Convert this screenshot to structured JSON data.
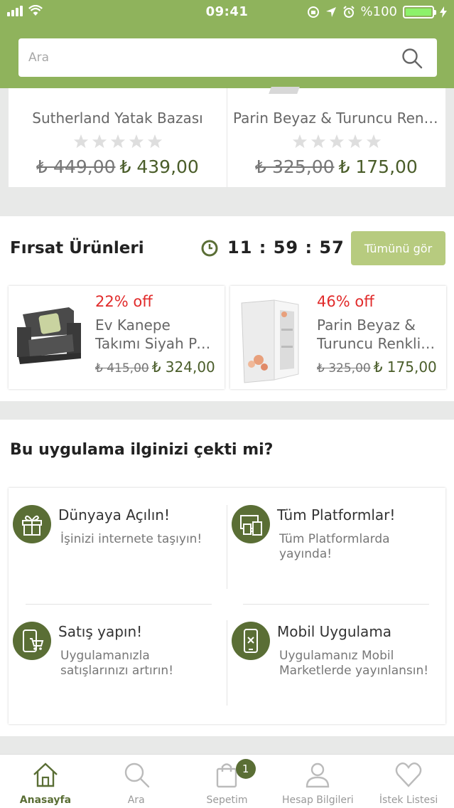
{
  "status_bar": {
    "time": "09:41",
    "battery_percent": "%100",
    "battery_level": 1.0
  },
  "search": {
    "placeholder": "Ara"
  },
  "products": [
    {
      "name": "Sutherland Yatak Bazası",
      "old_price": "₺ 449,00",
      "new_price": "₺ 439,00",
      "rating": 0,
      "max_rating": 5
    },
    {
      "name": "Parin Beyaz & Turuncu Renkli Çocuk Odası",
      "old_price": "₺ 325,00",
      "new_price": "₺ 175,00",
      "rating": 0,
      "max_rating": 5
    }
  ],
  "deals": {
    "title": "Fırsat Ürünleri",
    "countdown": "11 : 59 : 57",
    "see_all_label": "Tümünü gör",
    "items": [
      {
        "discount": "22% off",
        "name_line1": "Ev Kanepe",
        "name_line2": "Takımı Siyah Panama",
        "old_price": "₺ 415,00",
        "new_price": "₺ 324,00"
      },
      {
        "discount": "46% off",
        "name_line1": "Parin Beyaz &",
        "name_line2": "Turuncu Renkli Dolap",
        "old_price": "₺ 325,00",
        "new_price": "₺ 175,00"
      }
    ]
  },
  "promo": {
    "title": "Bu uygulama ilginizi çekti mi?",
    "features": [
      {
        "icon": "gift-icon",
        "title": "Dünyaya Açılın!",
        "desc": "İşinizi internete taşıyın!"
      },
      {
        "icon": "devices-icon",
        "title": "Tüm Platformlar!",
        "desc": "Tüm Platformlarda yayında!"
      },
      {
        "icon": "mobile-cart-icon",
        "title": "Satış yapın!",
        "desc": "Uygulamanızla satışlarınızı artırın!"
      },
      {
        "icon": "mobile-app-icon",
        "title": "Mobil Uygulama",
        "desc": "Uygulamanız Mobil Marketlerde yayınlansın!"
      }
    ]
  },
  "tabbar": {
    "tabs": [
      {
        "label": "Anasayfa",
        "icon": "home-icon",
        "active": true
      },
      {
        "label": "Ara",
        "icon": "search-icon",
        "active": false
      },
      {
        "label": "Sepetim",
        "icon": "bag-icon",
        "active": false,
        "badge": "1"
      },
      {
        "label": "Hesap Bilgileri",
        "icon": "user-icon",
        "active": false
      },
      {
        "label": "İstek Listesi",
        "icon": "heart-icon",
        "active": false
      }
    ]
  },
  "colors": {
    "brand_green": "#8fb35c",
    "dark_green": "#5a6e35",
    "button_green": "#b7cb7f",
    "discount_red": "#e12b2b",
    "price_green": "#4a5d2a"
  }
}
